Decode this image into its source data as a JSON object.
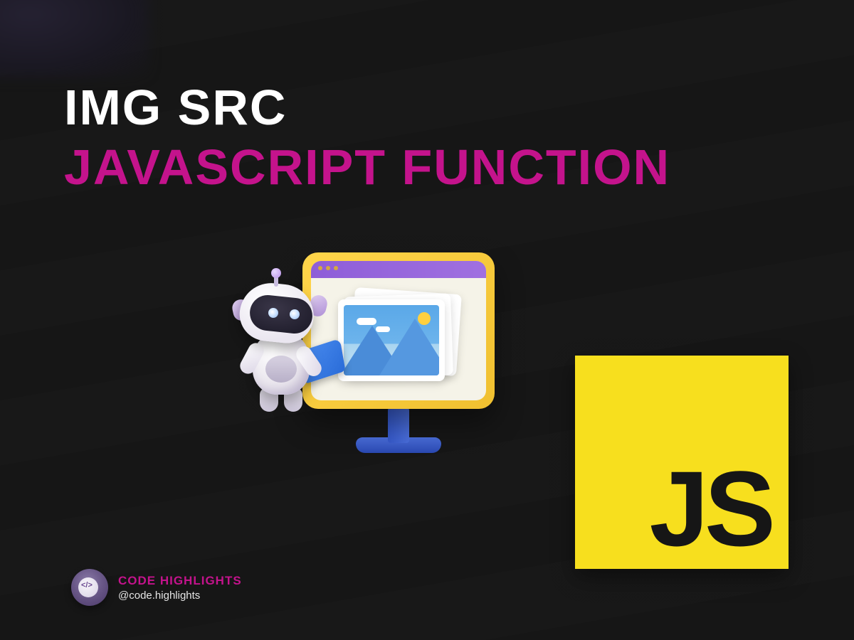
{
  "heading": {
    "line1": "IMG SRC",
    "line2": "JAVASCRIPT FUNCTION"
  },
  "js_logo": {
    "label": "JS"
  },
  "attribution": {
    "brand": "CODE HIGHLIGHTS",
    "handle": "@code.highlights"
  },
  "colors": {
    "accent_magenta": "#c4138c",
    "js_yellow": "#f7df1e",
    "background": "#161616"
  },
  "illustration": {
    "robot": "robot-mascot",
    "monitor": "desktop-monitor-with-image"
  }
}
